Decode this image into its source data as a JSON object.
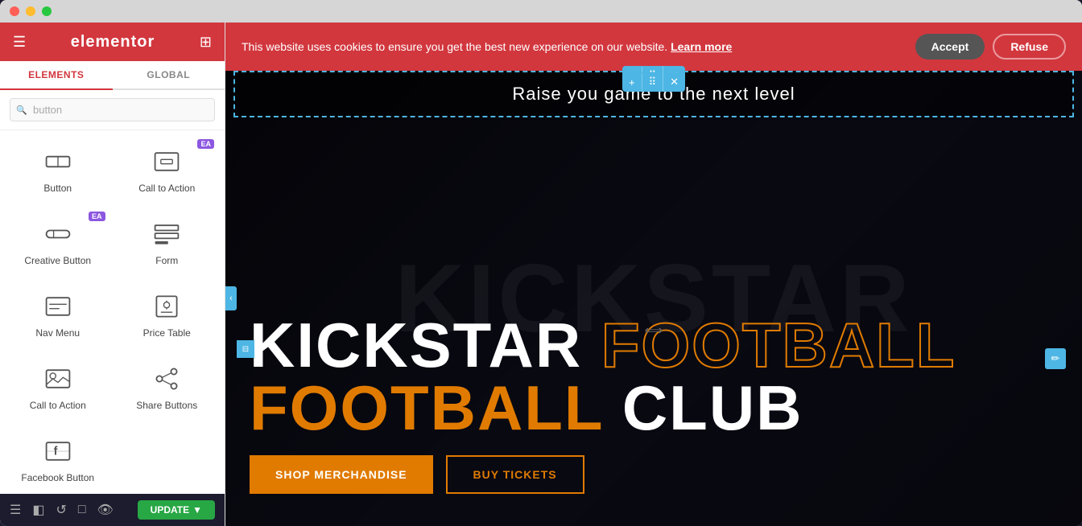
{
  "window": {
    "title": "Elementor"
  },
  "sidebar": {
    "logo": "elementor",
    "tabs": [
      {
        "id": "elements",
        "label": "ELEMENTS"
      },
      {
        "id": "global",
        "label": "GLOBAL"
      }
    ],
    "active_tab": "elements",
    "search_placeholder": "button",
    "widgets": [
      {
        "id": "button",
        "label": "Button",
        "icon": "button-icon",
        "ea": false
      },
      {
        "id": "call-to-action",
        "label": "Call to Action",
        "icon": "cta-icon",
        "ea": true
      },
      {
        "id": "creative-button",
        "label": "Creative Button",
        "icon": "creative-btn-icon",
        "ea": true
      },
      {
        "id": "form",
        "label": "Form",
        "icon": "form-icon",
        "ea": false
      },
      {
        "id": "nav-menu",
        "label": "Nav Menu",
        "icon": "nav-icon",
        "ea": false
      },
      {
        "id": "price-table",
        "label": "Price Table",
        "icon": "price-icon",
        "ea": false
      },
      {
        "id": "call-to-action-2",
        "label": "Call to Action",
        "icon": "cta2-icon",
        "ea": false
      },
      {
        "id": "share-buttons",
        "label": "Share Buttons",
        "icon": "share-icon",
        "ea": false
      },
      {
        "id": "facebook-button",
        "label": "Facebook Button",
        "icon": "fb-icon",
        "ea": false
      }
    ]
  },
  "bottom_toolbar": {
    "update_label": "UPDATE"
  },
  "cookie_banner": {
    "text": "This website uses cookies to ensure you get the best new experience on our website.",
    "learn_more": "Learn more",
    "accept": "Accept",
    "refuse": "Refuse"
  },
  "canvas": {
    "selected_text": "Raise you game to the next level",
    "hero_title_left": "KICKSTAR",
    "hero_title_mid": "FOOTBALL",
    "hero_title_right": "CLUB",
    "bg_watermark": "KICKSTAR",
    "shop_btn": "SHOP MERCHANDISE",
    "tickets_btn": "BUY TICKETS"
  },
  "toolbar": {
    "add": "+",
    "move": "⠿",
    "close": "✕"
  },
  "colors": {
    "primary": "#d2373e",
    "accent": "#4db6e4",
    "orange": "#e07b00",
    "dark": "#0d0d1a"
  }
}
